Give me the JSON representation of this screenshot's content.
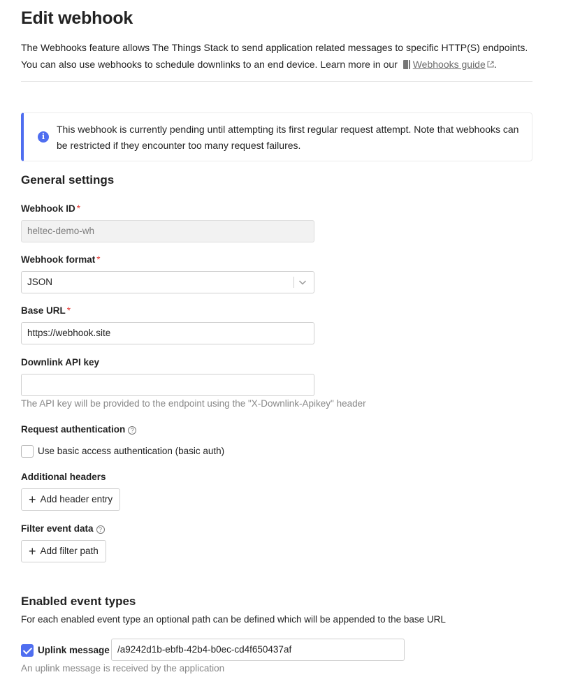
{
  "page": {
    "title": "Edit webhook",
    "intro_text": "The Webhooks feature allows The Things Stack to send application related messages to specific HTTP(S) endpoints. You can also use webhooks to schedule downlinks to an end device. Learn more in our ",
    "guide_link": "Webhooks guide",
    "intro_end": "."
  },
  "notice": {
    "text": "This webhook is currently pending until attempting its first regular request attempt. Note that webhooks can be restricted if they encounter too many request failures."
  },
  "general": {
    "heading": "General settings",
    "webhook_id": {
      "label": "Webhook ID",
      "required": "*",
      "value": "heltec-demo-wh"
    },
    "webhook_format": {
      "label": "Webhook format",
      "required": "*",
      "value": "JSON"
    },
    "base_url": {
      "label": "Base URL",
      "required": "*",
      "value": "https://webhook.site"
    },
    "downlink_api_key": {
      "label": "Downlink API key",
      "value": "",
      "help": "The API key will be provided to the endpoint using the \"X-Downlink-Apikey\" header"
    },
    "request_auth": {
      "label": "Request authentication",
      "checkbox_label": "Use basic access authentication (basic auth)",
      "checked": false
    },
    "additional_headers": {
      "label": "Additional headers",
      "button": "Add header entry"
    },
    "filter_event_data": {
      "label": "Filter event data",
      "button": "Add filter path"
    }
  },
  "events": {
    "heading": "Enabled event types",
    "description": "For each enabled event type an optional path can be defined which will be appended to the base URL",
    "uplink": {
      "label": "Uplink message",
      "checked": true,
      "path": "/a9242d1b-ebfb-42b4-b0ec-cd4f650437af",
      "help": "An uplink message is received by the application"
    }
  },
  "colors": {
    "accent": "#4f6ef0",
    "required": "#e53935"
  },
  "icons": [
    "book-icon",
    "external-link-icon",
    "info-icon",
    "chevron-down-icon",
    "help-icon",
    "plus-icon",
    "check-icon"
  ]
}
